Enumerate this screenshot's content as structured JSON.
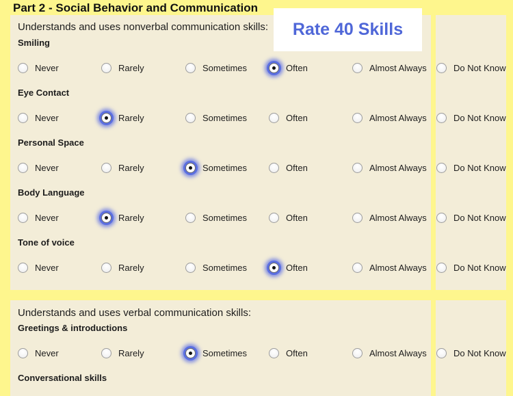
{
  "page_title": "Part 2 - Social Behavior and Communication",
  "banner_text": "Rate 40 Skills",
  "colors": {
    "background": "#FEF68D",
    "panel": "#F3EDD8",
    "banner_text": "#4F67D8",
    "selection_glow": "#5B6FE0"
  },
  "options": [
    "Never",
    "Rarely",
    "Sometimes",
    "Often",
    "Almost Always",
    "Do Not Know"
  ],
  "sections": [
    {
      "heading": "Understands and uses nonverbal communication skills:",
      "skills": [
        {
          "label": "Smiling",
          "selected": "Often"
        },
        {
          "label": "Eye Contact",
          "selected": "Rarely"
        },
        {
          "label": "Personal Space",
          "selected": "Sometimes"
        },
        {
          "label": "Body Language",
          "selected": "Rarely"
        },
        {
          "label": "Tone of voice",
          "selected": "Often"
        }
      ]
    },
    {
      "heading": "Understands and uses verbal communication skills:",
      "skills": [
        {
          "label": "Greetings & introductions",
          "selected": "Sometimes"
        },
        {
          "label": "Conversational skills",
          "selected": null
        }
      ]
    }
  ]
}
